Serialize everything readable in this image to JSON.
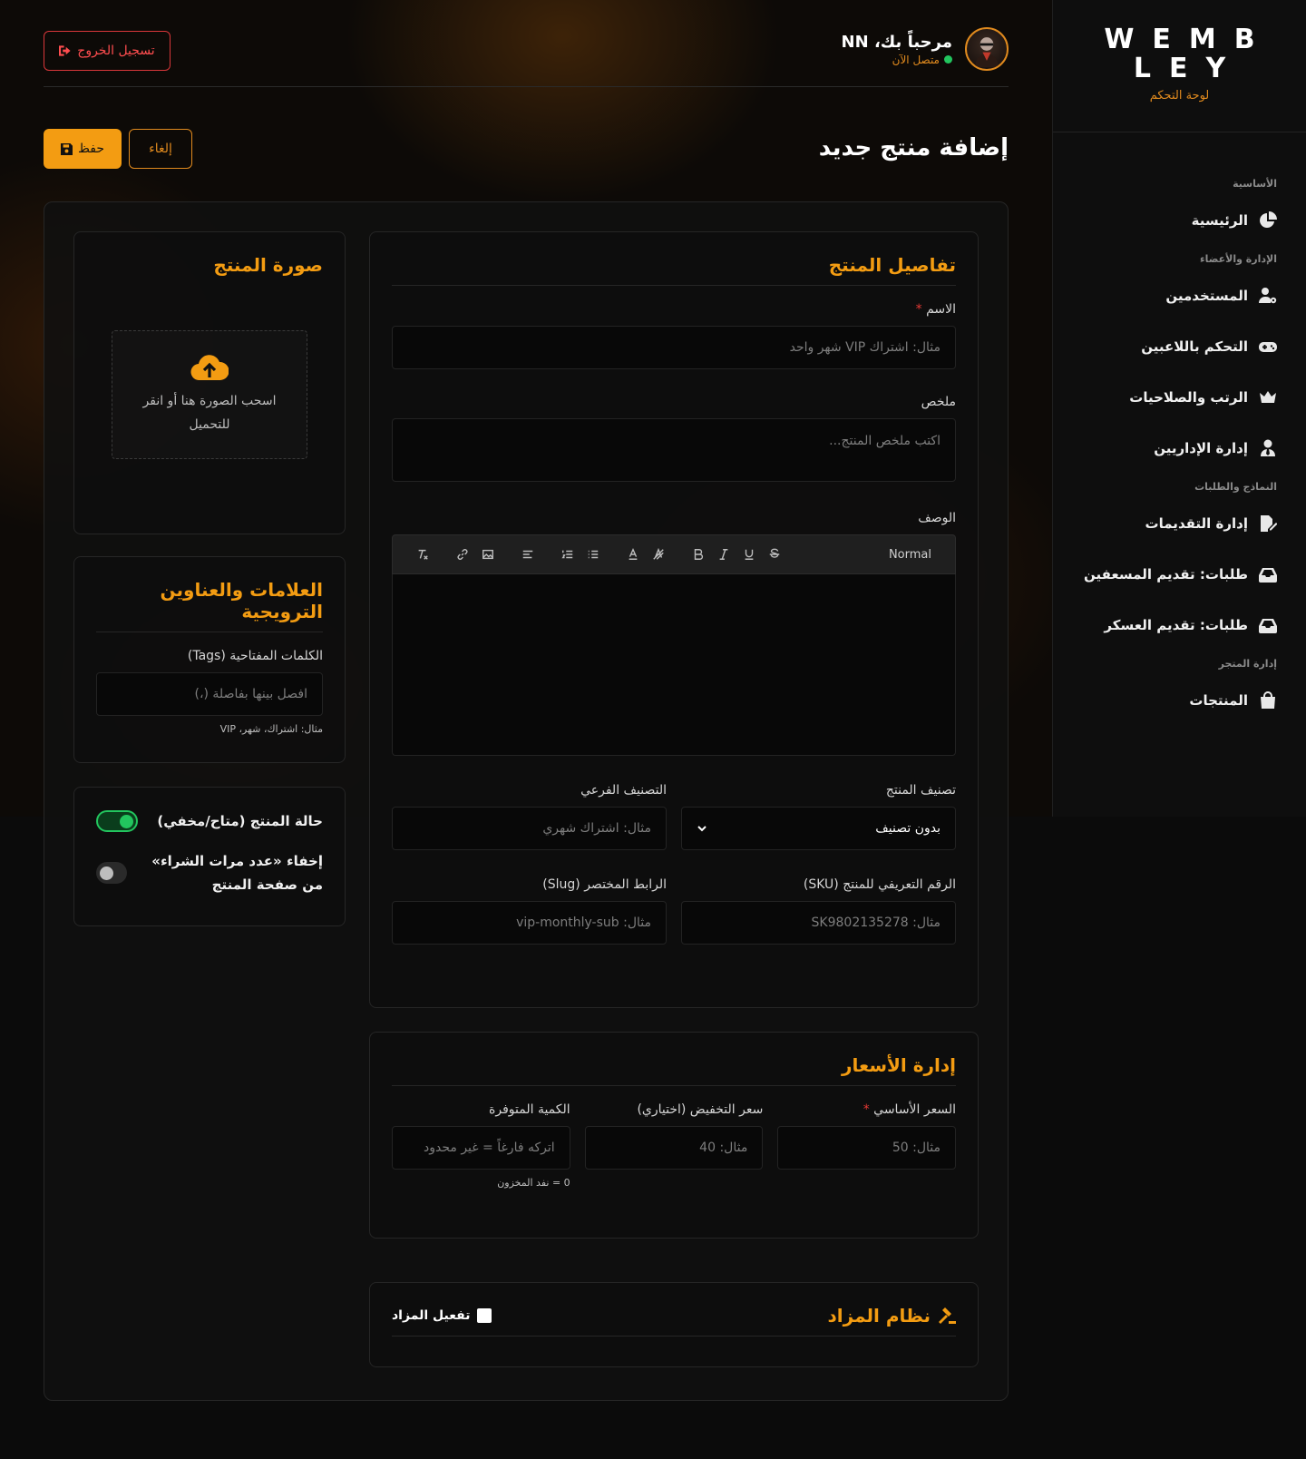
{
  "brand": {
    "name": "WEMBLEY",
    "subtitle": "لوحة التحكم"
  },
  "sidebar": {
    "sections": [
      {
        "title": "الأساسية",
        "items": [
          {
            "label": "الرئيسية",
            "icon": "chart-pie-icon"
          }
        ]
      },
      {
        "title": "الإدارة والأعضاء",
        "items": [
          {
            "label": "المستخدمين",
            "icon": "user-gear-icon"
          },
          {
            "label": "التحكم باللاعبين",
            "icon": "gamepad-icon"
          },
          {
            "label": "الرتب والصلاحيات",
            "icon": "crown-icon"
          },
          {
            "label": "إدارة الإداريين",
            "icon": "user-tie-icon"
          }
        ]
      },
      {
        "title": "النماذج والطلبات",
        "items": [
          {
            "label": "إدارة التقديمات",
            "icon": "file-signature-icon"
          },
          {
            "label": "طلبات: تقديم المسعفين",
            "icon": "inbox-icon"
          },
          {
            "label": "طلبات: تقديم العسكر",
            "icon": "inbox-icon"
          }
        ]
      },
      {
        "title": "إدارة المتجر",
        "items": [
          {
            "label": "المنتجات",
            "icon": "shopping-bag-icon"
          }
        ]
      }
    ]
  },
  "topbar": {
    "logout": "تسجيل الخروج",
    "welcome": "مرحباً بك، NN",
    "status": "متصل الآن"
  },
  "page": {
    "title": "إضافة منتج جديد",
    "save": "حفظ",
    "cancel": "إلغاء"
  },
  "details": {
    "title": "تفاصيل المنتج",
    "name_label": "الاسم",
    "name_placeholder": "مثال: اشتراك VIP شهر واحد",
    "summary_label": "ملخص",
    "summary_placeholder": "اكتب ملخص المنتج...",
    "description_label": "الوصف",
    "editor_format": "Normal",
    "category_label": "تصنيف المنتج",
    "category_value": "بدون تصنيف",
    "subcategory_label": "التصنيف الفرعي",
    "subcategory_placeholder": "مثال: اشتراك شهري",
    "sku_label": "الرقم التعريفي للمنتج (SKU)",
    "sku_placeholder": "مثال: SK9802135278",
    "slug_label": "الرابط المختصر (Slug)",
    "slug_placeholder": "مثال: vip-monthly-sub"
  },
  "pricing": {
    "title": "إدارة الأسعار",
    "base_label": "السعر الأساسي",
    "base_placeholder": "مثال: 50",
    "discount_label": "سعر التخفيض (اختياري)",
    "discount_placeholder": "مثال: 40",
    "qty_label": "الكمية المتوفرة",
    "qty_placeholder": "اتركه فارغاً = غير محدود",
    "qty_hint": "0 = نفد المخزون"
  },
  "auction": {
    "title": "نظام المزاد",
    "enable": "تفعيل المزاد"
  },
  "image": {
    "title": "صورة المنتج",
    "drop_text": "اسحب الصورة هنا أو انقر للتحميل"
  },
  "tags": {
    "title": "العلامات والعناوين الترويجية",
    "label": "الكلمات المفتاحية (Tags)",
    "placeholder": "افصل بينها بفاصلة (،)",
    "hint": "مثال: اشتراك، شهر، VIP"
  },
  "status": {
    "visible_label": "حالة المنتج (متاح/مخفي)",
    "visible_on": true,
    "hide_count_label": "إخفاء «عدد مرات الشراء» من صفحة المنتج",
    "hide_count_on": false
  },
  "colors": {
    "accent": "#f39c12",
    "danger": "#ff4d4f",
    "online": "#22c55e"
  }
}
